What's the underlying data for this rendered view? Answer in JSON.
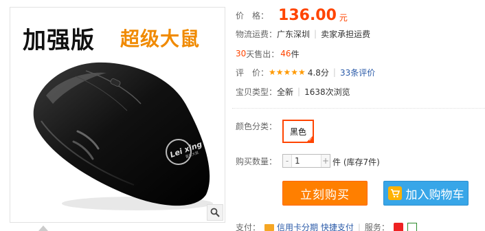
{
  "image": {
    "promo_left": "加强版",
    "promo_right": "超级大鼠",
    "brand_text": "Lei xing",
    "brand_sub": "雷兴",
    "brand_sub2": "雷星大鼠"
  },
  "price": {
    "label": "价　格：",
    "value": "136.00",
    "unit": "元"
  },
  "shipping": {
    "label": "物流运费：",
    "location": "广东深圳",
    "fee_note": "卖家承担运费"
  },
  "sales": {
    "days": "30",
    "label_suffix": "天售出：",
    "count": "46",
    "unit": "件"
  },
  "rating": {
    "label": "评　价：",
    "stars": "★★★★★",
    "score": "4.8分",
    "reviews_link": "33条评价"
  },
  "item_type": {
    "label": "宝贝类型：",
    "condition": "全新",
    "views": "1638次浏览"
  },
  "color": {
    "label": "颜色分类：",
    "selected": "黑色"
  },
  "quantity": {
    "label": "购买数量：",
    "minus": "-",
    "value": "1",
    "plus": "+",
    "unit_stock": "件 (库存7件)"
  },
  "actions": {
    "buy_now": "立刻购买",
    "add_to_cart": "加入购物车"
  },
  "bottom": {
    "pay_label": "支付：",
    "pay_methods": "信用卡分期  快捷支付",
    "service_label": "服务："
  },
  "colors": {
    "accent": "#ff4400",
    "buy_button": "#ff7f00",
    "cart_button": "#38a6e8",
    "link": "#2a5aa8",
    "star": "#ff9900"
  }
}
